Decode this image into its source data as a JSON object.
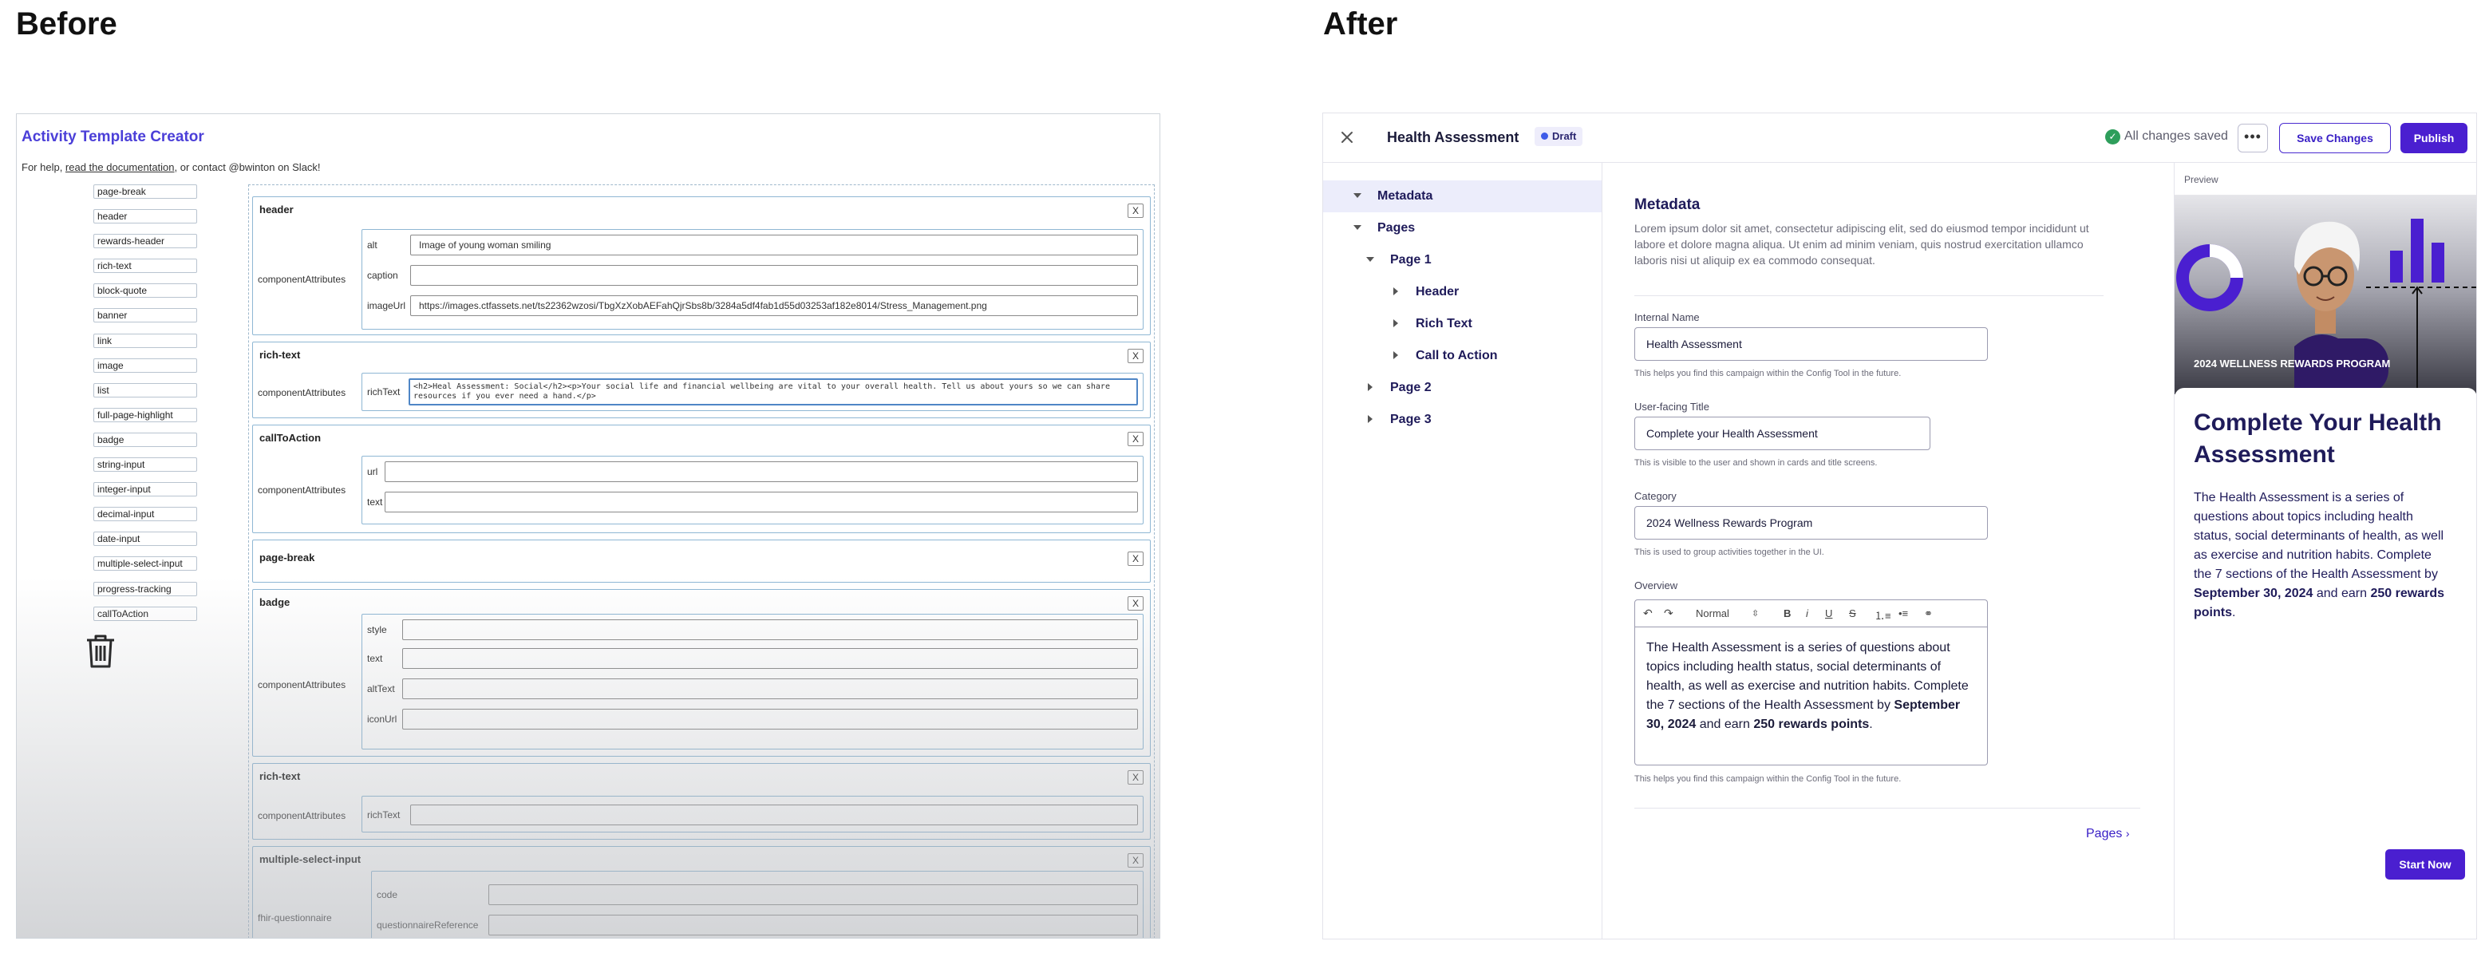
{
  "headings": {
    "before": "Before",
    "after": "After"
  },
  "before": {
    "title": "Activity Template Creator",
    "help": {
      "prefix": "For help, ",
      "link": "read the documentation",
      "suffix": ", or contact @bwinton on Slack!"
    },
    "palette": [
      "page-break",
      "header",
      "rewards-header",
      "rich-text",
      "block-quote",
      "banner",
      "link",
      "image",
      "list",
      "full-page-highlight",
      "badge",
      "string-input",
      "integer-input",
      "decimal-input",
      "date-input",
      "multiple-select-input",
      "progress-tracking",
      "callToAction"
    ],
    "common": {
      "component_attributes": "componentAttributes",
      "remove": "X"
    },
    "blocks": {
      "header": {
        "title": "header",
        "fields": [
          {
            "label": "alt",
            "value": "Image of young woman smiling"
          },
          {
            "label": "caption",
            "value": ""
          },
          {
            "label": "imageUrl",
            "value": "https://images.ctfassets.net/ts22362wzosi/TbgXzXobAEFahQjrSbs8b/3284a5df4fab1d55d03253af182e8014/Stress_Management.png"
          }
        ]
      },
      "rich_text_1": {
        "title": "rich-text",
        "fields": [
          {
            "label": "richText",
            "value": "<h2>Heal Assessment: Social</h2><p>Your social life and financial wellbeing are vital to your overall health. Tell us about yours so we can share resources if you ever need a hand.</p>"
          }
        ]
      },
      "cta": {
        "title": "callToAction",
        "fields": [
          {
            "label": "url",
            "value": ""
          },
          {
            "label": "text",
            "value": ""
          }
        ]
      },
      "page_break": {
        "title": "page-break"
      },
      "badge": {
        "title": "badge",
        "fields": [
          {
            "label": "style",
            "value": ""
          },
          {
            "label": "text",
            "value": ""
          },
          {
            "label": "altText",
            "value": ""
          },
          {
            "label": "iconUrl",
            "value": ""
          }
        ]
      },
      "rich_text_2": {
        "title": "rich-text",
        "fields": [
          {
            "label": "richText",
            "value": ""
          }
        ]
      },
      "msi": {
        "title": "multiple-select-input",
        "group_label": "fhir-questionnaire",
        "fields": [
          {
            "label": "code",
            "value": ""
          },
          {
            "label": "questionnaireReference",
            "value": ""
          }
        ]
      }
    }
  },
  "after": {
    "title": "Health Assessment",
    "status": "Draft",
    "saved": "All changes saved",
    "more": "•••",
    "save_button": "Save Changes",
    "publish_button": "Publish",
    "nav": {
      "metadata": "Metadata",
      "pages": "Pages",
      "page1": "Page 1",
      "header": "Header",
      "rich_text": "Rich Text",
      "cta": "Call to Action",
      "page2": "Page 2",
      "page3": "Page 3"
    },
    "form": {
      "heading": "Metadata",
      "description": "Lorem ipsum dolor sit amet, consectetur adipiscing elit, sed do eiusmod tempor incididunt ut labore et dolore magna aliqua. Ut enim ad minim veniam, quis nostrud exercitation ullamco laboris nisi ut aliquip ex ea commodo consequat.",
      "internal_name": {
        "label": "Internal Name",
        "value": "Health Assessment",
        "help": "This helps you find this campaign within the Config Tool in the future."
      },
      "user_title": {
        "label": "User-facing Title",
        "value": "Complete your Health Assessment",
        "help": "This is visible to the user and shown in cards and title screens."
      },
      "category": {
        "label": "Category",
        "value": "2024 Wellness Rewards Program",
        "help": "This is used to group activities together in the UI."
      },
      "overview": {
        "label": "Overview",
        "style": "Normal",
        "text_a": "The Health Assessment is a series of questions about topics including health status, social determinants of health, as well as exercise and nutrition habits. Complete the 7 sections of the Health Assessment by ",
        "bold_date": "September 30, 2024",
        "text_b": " and earn ",
        "bold_points": "250 rewards points",
        "text_c": ".",
        "help": "This helps you find this campaign within the Config Tool in the future."
      },
      "next_link": "Pages"
    },
    "preview": {
      "label": "Preview",
      "banner": "2024 WELLNESS REWARDS PROGRAM",
      "heading": "Complete Your Health Assessment",
      "text_a": "The Health Assessment is a series of questions about topics including health status, social determinants of health, as well as exercise and nutrition habits. Complete the 7 sections of the Health Assessment by ",
      "bold_date": "September 30, 2024",
      "text_b": " and earn ",
      "bold_points": "250 rewards points",
      "text_c": ".",
      "button": "Start Now"
    }
  }
}
